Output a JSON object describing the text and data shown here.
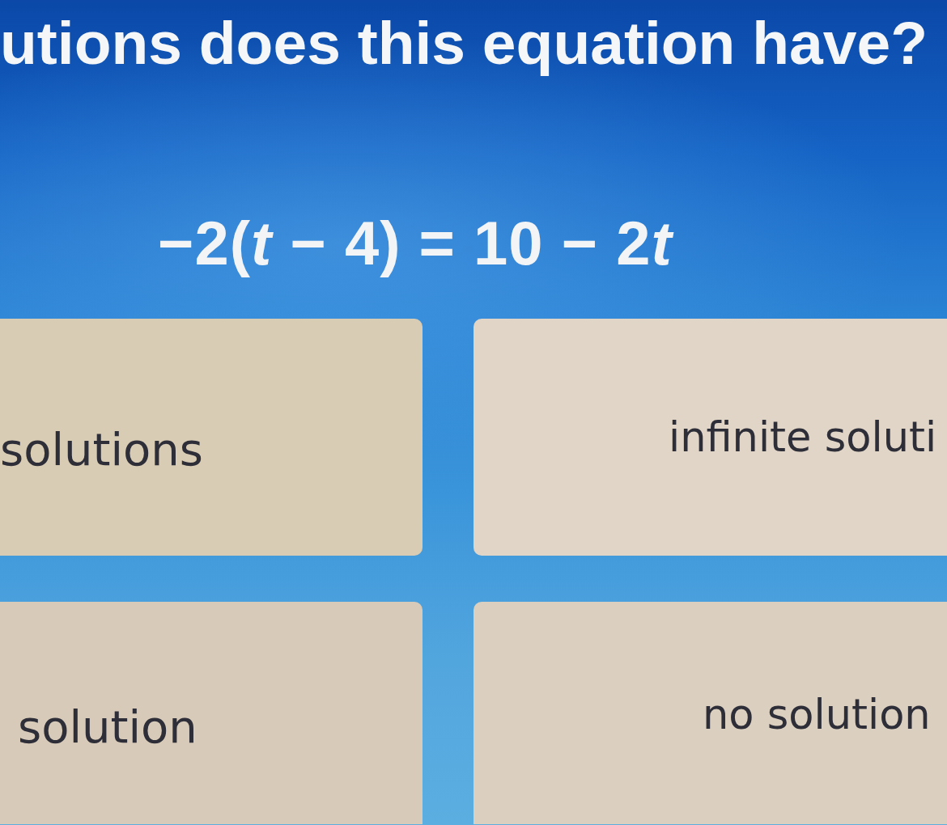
{
  "question": {
    "text": "utions does this equation have?"
  },
  "equation": [
    {
      "kind": "term",
      "text": "−2("
    },
    {
      "kind": "variable",
      "text": "t"
    },
    {
      "kind": "term",
      "text": " − 4) = 10 − 2"
    },
    {
      "kind": "variable",
      "text": "t"
    }
  ],
  "options": [
    {
      "label": "solutions"
    },
    {
      "label": "infinite soluti"
    },
    {
      "label": "solution"
    },
    {
      "label": "no solution"
    }
  ]
}
